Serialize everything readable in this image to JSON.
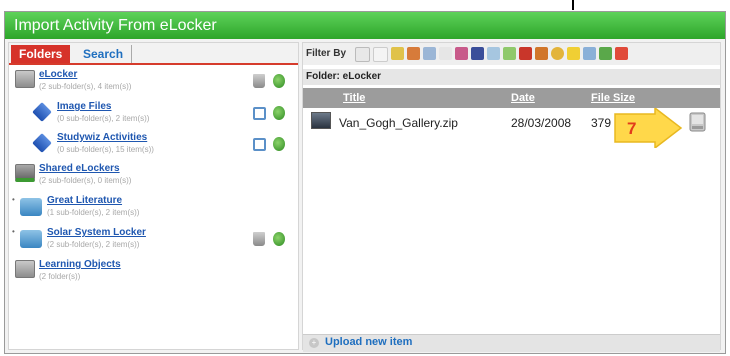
{
  "window": {
    "title": "Import Activity From eLocker"
  },
  "tabs": {
    "folders": "Folders",
    "search": "Search"
  },
  "folders": [
    {
      "name": "eLocker",
      "sub": "(2 sub-folder(s), 4 item(s))",
      "icon": "locker-icon"
    },
    {
      "name": "Image Files",
      "sub": "(0 sub-folder(s), 2 item(s))",
      "icon": "diamond-folder-icon"
    },
    {
      "name": "Studywiz Activities",
      "sub": "(0 sub-folder(s), 15 item(s))",
      "icon": "diamond-folder-icon"
    },
    {
      "name": "Shared eLockers",
      "sub": "(2 sub-folder(s), 0 item(s))",
      "icon": "shared-locker-icon"
    },
    {
      "name": "Great Literature",
      "sub": "(1 sub-folder(s), 2 item(s))",
      "icon": "books-icon"
    },
    {
      "name": "Solar System Locker",
      "sub": "(2 sub-folder(s), 2 item(s))",
      "icon": "books-icon"
    },
    {
      "name": "Learning Objects",
      "sub": "(2 folder(s))",
      "icon": "locker-icon"
    }
  ],
  "filter": {
    "label": "Filter By"
  },
  "current_folder": {
    "label": "Folder: eLocker"
  },
  "columns": {
    "title": "Title",
    "date": "Date",
    "size": "File Size"
  },
  "files": [
    {
      "name": "Van_Gogh_Gallery.zip",
      "date": "28/03/2008",
      "size": "379"
    }
  ],
  "callout": {
    "number": "7"
  },
  "upload": {
    "label": "Upload new item"
  },
  "colors": {
    "title_bar": "#3cb638",
    "folders_tab": "#d6332a",
    "link": "#1f57b0",
    "header_gray": "#9c9c9c",
    "callout_fill": "#ffd84a",
    "callout_text": "#e23b1b"
  }
}
